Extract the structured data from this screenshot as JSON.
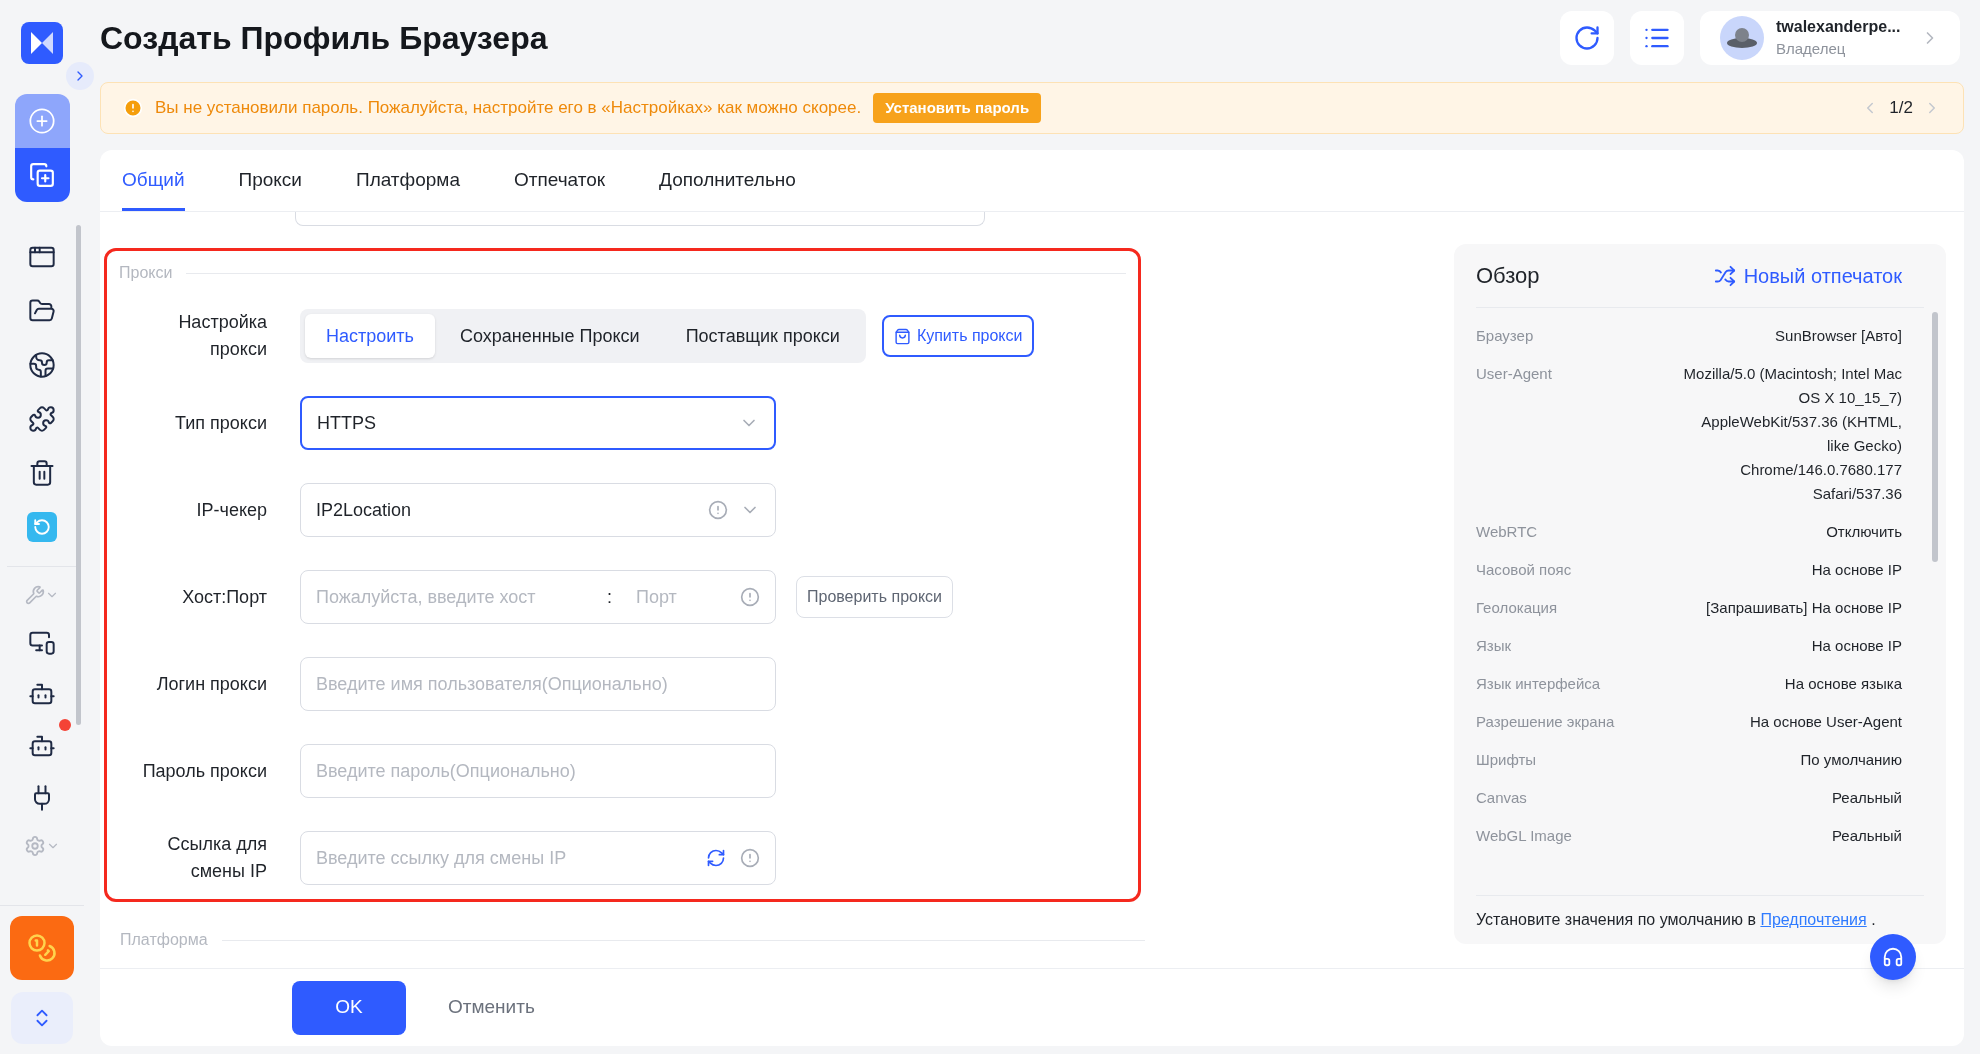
{
  "header": {
    "title": "Создать Профиль Браузера",
    "user": {
      "name": "twalexanderpe...",
      "role": "Владелец"
    }
  },
  "sidebar": {
    "notification_dot": true
  },
  "alert": {
    "text": "Вы не установили пароль. Пожалуйста, настройте его в «Настройках» как можно скорее.",
    "button": "Установить пароль",
    "pager": "1/2"
  },
  "tabs": [
    {
      "label": "Общий",
      "selected": true
    },
    {
      "label": "Прокси",
      "selected": false
    },
    {
      "label": "Платформа",
      "selected": false
    },
    {
      "label": "Отпечаток",
      "selected": false
    },
    {
      "label": "Дополнительно",
      "selected": false
    }
  ],
  "proxy_section": {
    "title": "Прокси",
    "highlighted": true,
    "setup": {
      "label": "Настройка прокси",
      "options": [
        {
          "label": "Настроить",
          "selected": true
        },
        {
          "label": "Сохраненные Прокси",
          "selected": false
        },
        {
          "label": "Поставщик прокси",
          "selected": false
        }
      ],
      "buy_button": "Купить прокси"
    },
    "fields": [
      {
        "kind": "select",
        "label": "Тип прокси",
        "value": "HTTPS",
        "focused": true,
        "info": false
      },
      {
        "kind": "select",
        "label": "IP-чекер",
        "value": "IP2Location",
        "focused": false,
        "info": true
      },
      {
        "kind": "host_port",
        "label": "Хост:Порт",
        "placeholder": "Пожалуйста, введите хост",
        "separator": ":",
        "port_placeholder": "Порт",
        "button": "Проверить прокси"
      },
      {
        "kind": "input",
        "label": "Логин прокси",
        "placeholder": "Введите имя пользователя(Опционально)"
      },
      {
        "kind": "input",
        "label": "Пароль прокси",
        "placeholder": "Введите пароль(Опционально)"
      },
      {
        "kind": "link_input",
        "label": "Ссылка для смены IP",
        "placeholder": "Введите ссылку для смены IP"
      }
    ]
  },
  "next_section": {
    "title": "Платформа"
  },
  "overview": {
    "title": "Обзор",
    "action": "Новый отпечаток",
    "rows": [
      {
        "label": "Браузер",
        "value": "SunBrowser [Авто]"
      },
      {
        "label": "User-Agent",
        "value": "Mozilla/5.0 (Macintosh; Intel Mac OS X 10_15_7) AppleWebKit/537.36 (KHTML, like Gecko) Chrome/146.0.7680.177 Safari/537.36"
      },
      {
        "label": "WebRTC",
        "value": "Отключить"
      },
      {
        "label": "Часовой пояс",
        "value": "На основе IP"
      },
      {
        "label": "Геолокация",
        "value": "[Запрашивать] На основе IP"
      },
      {
        "label": "Язык",
        "value": "На основе IP"
      },
      {
        "label": "Язык интерфейса",
        "value": "На основе языка"
      },
      {
        "label": "Разрешение экрана",
        "value": "На основе User-Agent"
      },
      {
        "label": "Шрифты",
        "value": "По умолчанию"
      },
      {
        "label": "Canvas",
        "value": "Реальный"
      },
      {
        "label": "WebGL Image",
        "value": "Реальный"
      }
    ],
    "footer": {
      "text": "Установите значения по умолчанию в",
      "link": "Предпочтения",
      "end": "."
    }
  },
  "footer_buttons": {
    "ok": "OK",
    "cancel": "Отменить"
  }
}
